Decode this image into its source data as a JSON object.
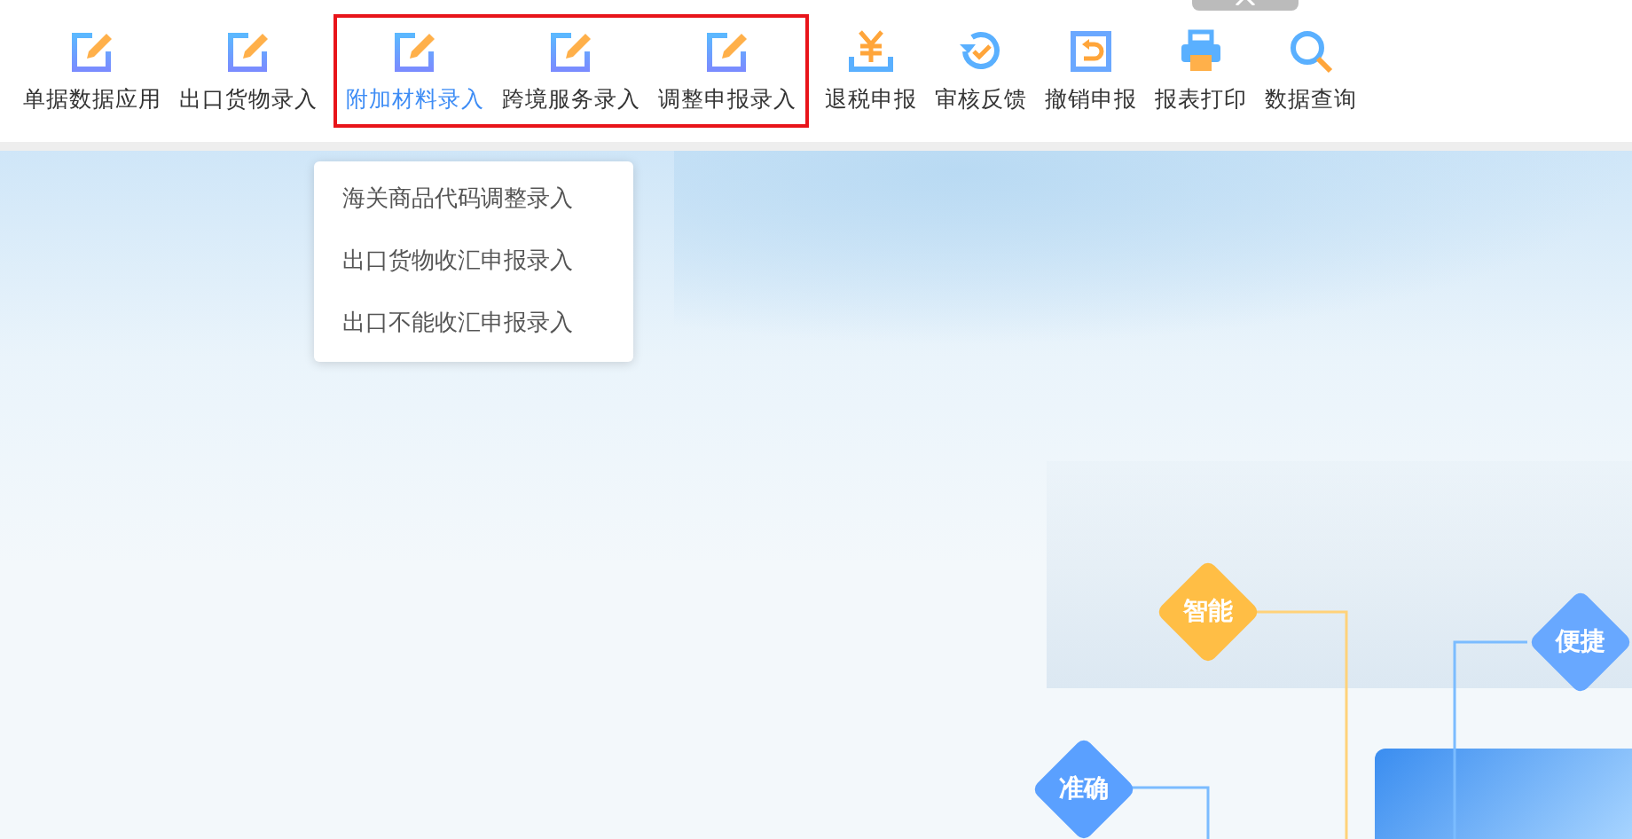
{
  "toolbar": {
    "items": [
      {
        "label": "单据数据应用",
        "kind": "edit",
        "selected": false,
        "highlighted": false
      },
      {
        "label": "出口货物录入",
        "kind": "edit",
        "selected": false,
        "highlighted": false
      },
      {
        "label": "附加材料录入",
        "kind": "edit",
        "selected": true,
        "highlighted": true
      },
      {
        "label": "跨境服务录入",
        "kind": "edit",
        "selected": false,
        "highlighted": true
      },
      {
        "label": "调整申报录入",
        "kind": "edit",
        "selected": false,
        "highlighted": true
      },
      {
        "label": "退税申报",
        "kind": "yuan",
        "selected": false,
        "highlighted": false
      },
      {
        "label": "审核反馈",
        "kind": "refresh",
        "selected": false,
        "highlighted": false
      },
      {
        "label": "撤销申报",
        "kind": "undo",
        "selected": false,
        "highlighted": false
      },
      {
        "label": "报表打印",
        "kind": "print",
        "selected": false,
        "highlighted": false
      },
      {
        "label": "数据查询",
        "kind": "search",
        "selected": false,
        "highlighted": false
      }
    ]
  },
  "dropdown": {
    "items": [
      "海关商品代码调整录入",
      "出口货物收汇申报录入",
      "出口不能收汇申报录入"
    ]
  },
  "banner": {
    "badges": [
      {
        "label": "智能",
        "color": "#ffbe45"
      },
      {
        "label": "便捷",
        "color": "#68a8ff"
      },
      {
        "label": "准确",
        "color": "#5aa0ff"
      }
    ]
  }
}
